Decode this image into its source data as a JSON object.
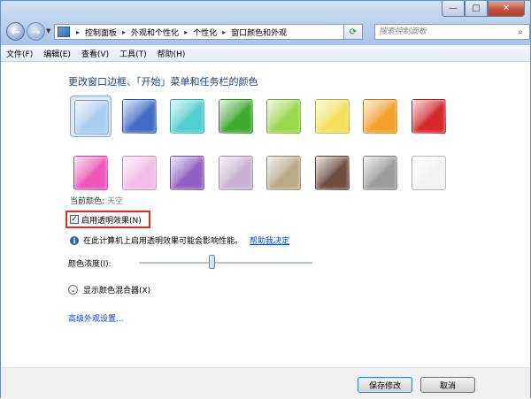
{
  "window": {
    "controls": {
      "minimize": "—",
      "maximize": "□",
      "close": "✕"
    }
  },
  "nav": {
    "breadcrumb": [
      "控制面板",
      "外观和个性化",
      "个性化",
      "窗口颜色和外观"
    ],
    "search_placeholder": "搜索控制面板"
  },
  "menu": {
    "items": [
      "文件(F)",
      "编辑(E)",
      "查看(V)",
      "工具(T)",
      "帮助(H)"
    ]
  },
  "main": {
    "heading": "更改窗口边框、「开始」菜单和任务栏的颜色",
    "swatches": [
      {
        "color": "#a9cdf1",
        "selected": true
      },
      {
        "color": "#3f6dc3"
      },
      {
        "color": "#4fcfcf"
      },
      {
        "color": "#3eaa2e"
      },
      {
        "color": "#9ad64a"
      },
      {
        "color": "#f2e15c"
      },
      {
        "color": "#f4a12a"
      },
      {
        "color": "#d6272b"
      },
      {
        "color": "#ee55b8"
      },
      {
        "color": "#f4bce9"
      },
      {
        "color": "#8f61c2"
      },
      {
        "color": "#c7b3d0"
      },
      {
        "color": "#b9ab8a"
      },
      {
        "color": "#6e4e43"
      },
      {
        "color": "#9c9c9c"
      },
      {
        "color": "#f3f3f3"
      }
    ],
    "current_color_label": "当前颜色:",
    "current_color_value": "天空",
    "transparency_label": "启用透明效果(N)",
    "transparency_checked": true,
    "info_text": "在此计算机上启用透明效果可能会影响性能。",
    "help_link": "帮助我决定",
    "intensity_label": "颜色浓度(I):",
    "intensity_value": 0.42,
    "mixer_label": "显示颜色混合器(X)",
    "advanced_link": "高级外观设置..."
  },
  "footer": {
    "save_label": "保存修改",
    "cancel_label": "取消"
  }
}
